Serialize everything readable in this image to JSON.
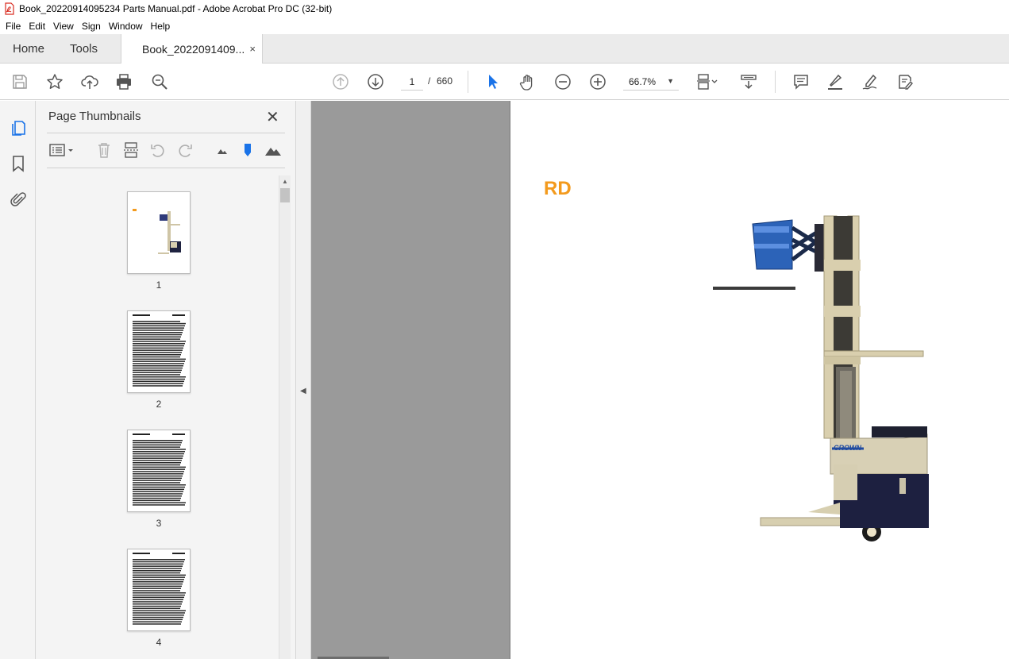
{
  "window": {
    "title": "Book_20220914095234 Parts Manual.pdf - Adobe Acrobat Pro DC (32-bit)"
  },
  "menu": [
    "File",
    "Edit",
    "View",
    "Sign",
    "Window",
    "Help"
  ],
  "tabs": {
    "home": "Home",
    "tools": "Tools",
    "document": "Book_2022091409...",
    "close": "×"
  },
  "toolbar": {
    "page_current": "1",
    "page_separator": "/",
    "page_total": "660",
    "zoom": "66.7%"
  },
  "panel": {
    "title": "Page Thumbnails",
    "close": "✕",
    "thumbnails": [
      {
        "label": "1"
      },
      {
        "label": "2"
      },
      {
        "label": "3"
      },
      {
        "label": "4"
      }
    ]
  },
  "document": {
    "heading": "RD",
    "crown_logo": "CROWN"
  },
  "colors": {
    "accent_blue": "#1a73e8",
    "heading_orange": "#f39a1d",
    "pdf_red": "#d92c21"
  },
  "icons": [
    "save-icon",
    "bookmark-star-icon",
    "upload-icon",
    "print-icon",
    "search-zoom-icon",
    "prev-page-icon",
    "next-page-icon",
    "select-cursor-icon",
    "hand-icon",
    "zoom-out-icon",
    "zoom-in-icon",
    "page-fit-icon",
    "scroll-mode-icon",
    "comment-icon",
    "highlight-icon",
    "draw-icon",
    "fill-sign-icon",
    "thumbnails-icon",
    "bookmarks-icon",
    "attachments-icon"
  ]
}
